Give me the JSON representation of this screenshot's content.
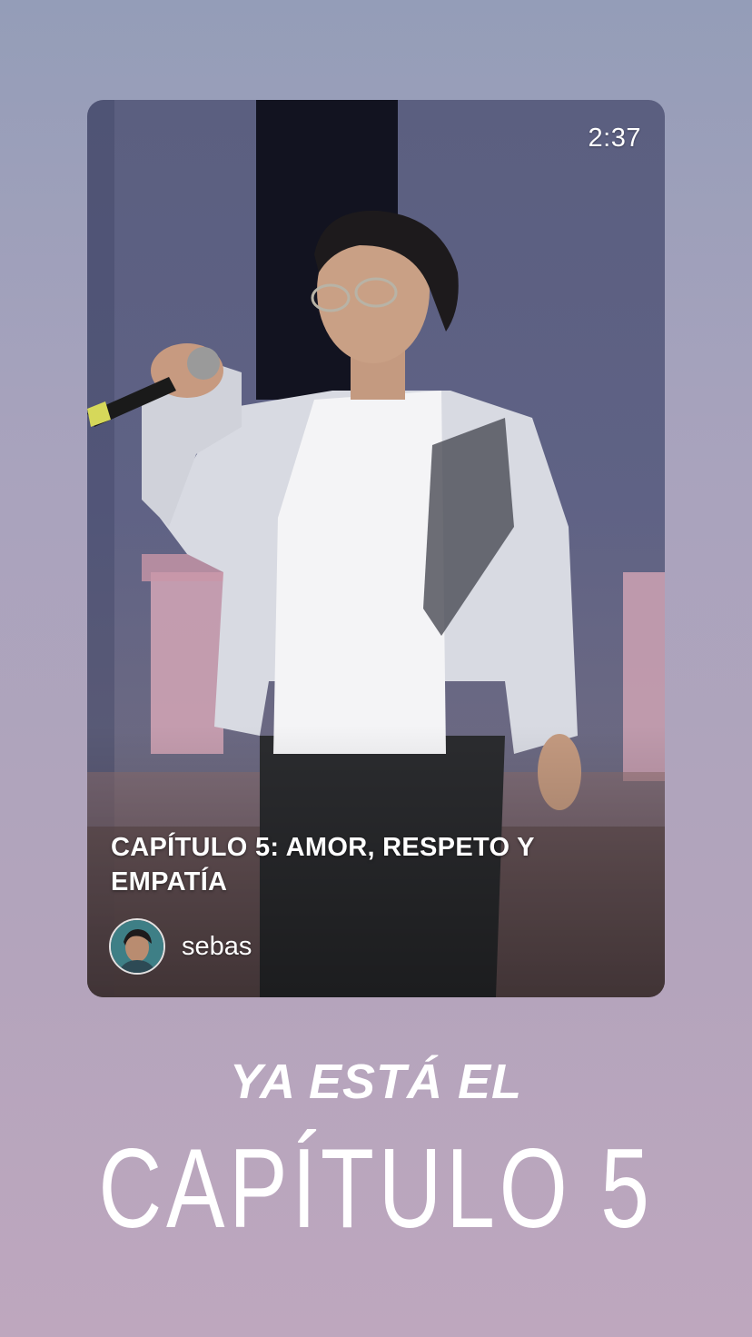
{
  "video_card": {
    "duration": "2:37",
    "title": "CAPÍTULO 5: AMOR, RESPETO Y EMPATÍA",
    "author": "sebas"
  },
  "caption": {
    "line1": "YA ESTÁ EL",
    "line2": "CAPÍTULO 5"
  }
}
